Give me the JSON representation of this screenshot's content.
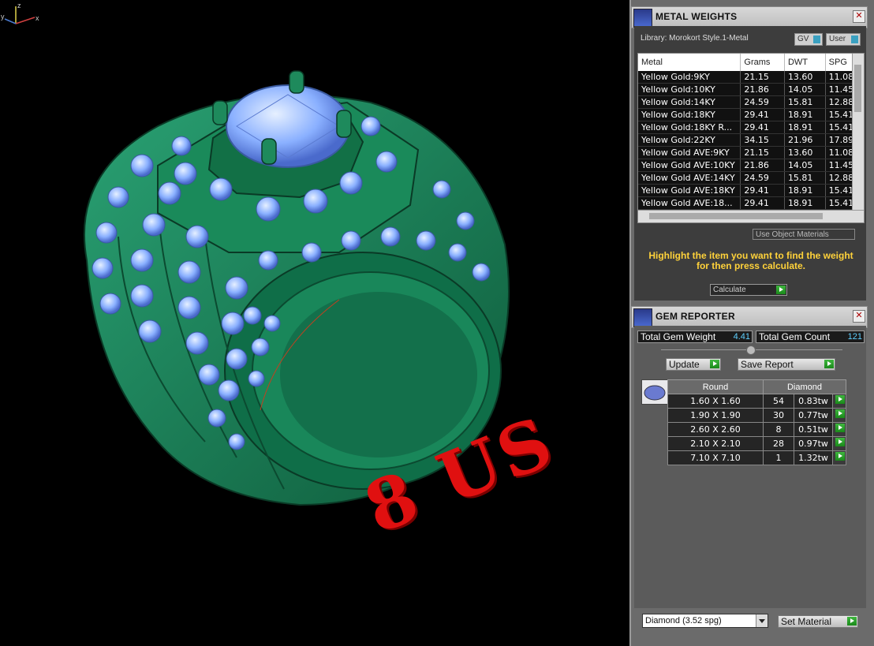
{
  "viewport": {
    "engraving": "8 US",
    "axes": {
      "x": "x",
      "y": "y",
      "z": "z"
    }
  },
  "metal_weights": {
    "title": "METAL WEIGHTS",
    "close": "✕",
    "library": "Library: Morokort Style.1-Metal",
    "toggle_gv": "GV",
    "toggle_user": "User",
    "columns": [
      "Metal",
      "Grams",
      "DWT",
      "SPG"
    ],
    "rows": [
      [
        "Yellow Gold:9KY",
        "21.15",
        "13.60",
        "11.08"
      ],
      [
        "Yellow Gold:10KY",
        "21.86",
        "14.05",
        "11.45"
      ],
      [
        "Yellow Gold:14KY",
        "24.59",
        "15.81",
        "12.88"
      ],
      [
        "Yellow Gold:18KY",
        "29.41",
        "18.91",
        "15.41"
      ],
      [
        "Yellow Gold:18KY R...",
        "29.41",
        "18.91",
        "15.41"
      ],
      [
        "Yellow Gold:22KY",
        "34.15",
        "21.96",
        "17.89"
      ],
      [
        "Yellow Gold AVE:9KY",
        "21.15",
        "13.60",
        "11.08"
      ],
      [
        "Yellow Gold AVE:10KY",
        "21.86",
        "14.05",
        "11.45"
      ],
      [
        "Yellow Gold AVE:14KY",
        "24.59",
        "15.81",
        "12.88"
      ],
      [
        "Yellow Gold AVE:18KY",
        "29.41",
        "18.91",
        "15.41"
      ],
      [
        "Yellow Gold AVE:18...",
        "29.41",
        "18.91",
        "15.41"
      ]
    ],
    "use_object_materials": "Use Object Materials",
    "hint": "Highlight the item you want to find the weight for then press calculate.",
    "calculate": "Calculate"
  },
  "gem_reporter": {
    "title": "GEM REPORTER",
    "close": "✕",
    "total_weight_label": "Total Gem Weight",
    "total_weight_value": "4.41",
    "total_count_label": "Total Gem Count",
    "total_count_value": "121",
    "update": "Update",
    "save_report": "Save Report",
    "shape_header": "Round",
    "material_header": "Diamond",
    "gems": [
      {
        "size": "1.60 X 1.60",
        "count": "54",
        "weight": "0.83tw"
      },
      {
        "size": "1.90 X 1.90",
        "count": "30",
        "weight": "0.77tw"
      },
      {
        "size": "2.60 X 2.60",
        "count": "8",
        "weight": "0.51tw"
      },
      {
        "size": "2.10 X 2.10",
        "count": "28",
        "weight": "0.97tw"
      },
      {
        "size": "7.10 X 7.10",
        "count": "1",
        "weight": "1.32tw"
      }
    ],
    "material_select": "Diamond    (3.52 spg)",
    "set_material": "Set Material"
  },
  "colors": {
    "metal": "#1e8a5c",
    "gem": "#8ab0ff",
    "engrave": "#e01010",
    "hint": "#ffd23a",
    "accent_value": "#5fd0ff"
  }
}
